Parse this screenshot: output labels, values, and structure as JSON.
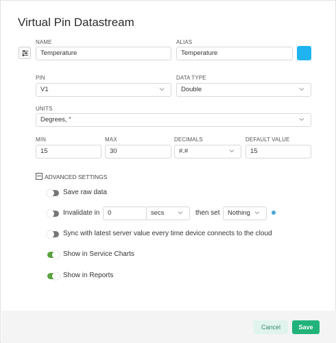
{
  "dialog": {
    "title": "Virtual Pin Datastream"
  },
  "fields": {
    "name": {
      "label": "NAME",
      "value": "Temperature"
    },
    "alias": {
      "label": "ALIAS",
      "value": "Temperature"
    },
    "color": "#1fb4f0",
    "pin": {
      "label": "PIN",
      "value": "V1"
    },
    "data_type": {
      "label": "DATA TYPE",
      "value": "Double"
    },
    "units": {
      "label": "UNITS",
      "value": "Degrees, °"
    },
    "min": {
      "label": "MIN",
      "value": "15"
    },
    "max": {
      "label": "MAX",
      "value": "30"
    },
    "decimals": {
      "label": "DECIMALS",
      "value": "#.#"
    },
    "default_value": {
      "label": "DEFAULT VALUE",
      "value": "15"
    }
  },
  "advanced": {
    "label": "ADVANCED SETTINGS",
    "save_raw": {
      "label": "Save raw data",
      "enabled": false
    },
    "invalidate": {
      "label": "Invalidate in",
      "enabled": false,
      "amount": "0",
      "unit": "secs",
      "then_label": "then set",
      "then_value": "Nothing"
    },
    "sync": {
      "label": "Sync with latest server value every time device connects to the cloud",
      "enabled": false
    },
    "service_charts": {
      "label": "Show in Service Charts",
      "enabled": true
    },
    "reports": {
      "label": "Show in Reports",
      "enabled": true
    }
  },
  "footer": {
    "cancel_label": "Cancel",
    "save_label": "Save"
  },
  "colors": {
    "accent": "#22b37b",
    "toggle_on": "#5aa33c",
    "toggle_off": "#777777"
  }
}
